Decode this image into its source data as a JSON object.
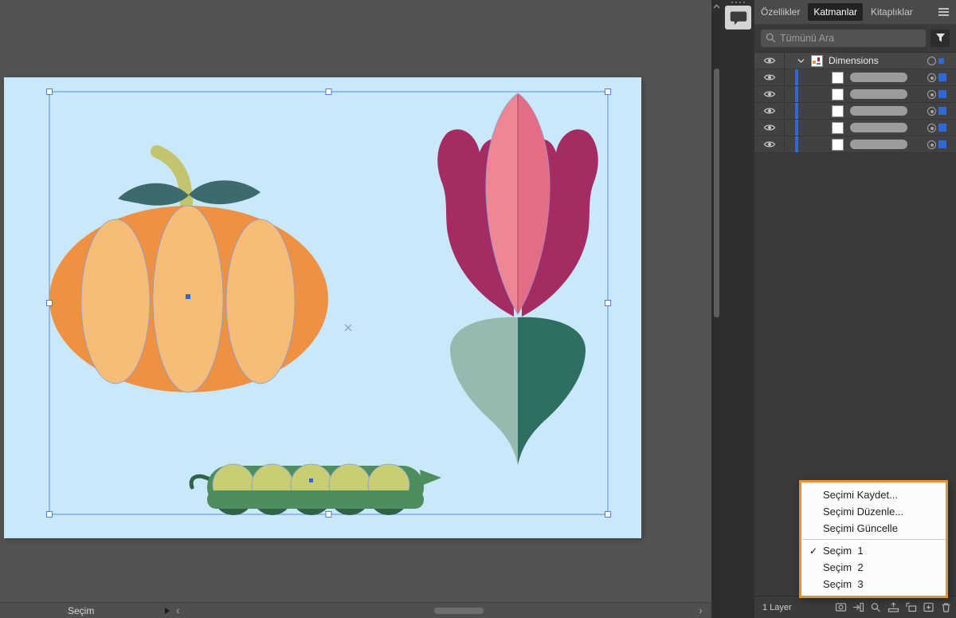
{
  "colors": {
    "accent_blue": "#2e68d9",
    "selection_blue": "#5b8ddb",
    "canvas_bg": "#535353",
    "artboard_bg": "#c9e8fa",
    "panel_bg": "#3a3a3a",
    "menu_highlight_orange": "#e8912f",
    "pumpkin_orange": "#ef9143",
    "pumpkin_light": "#f7bd78",
    "pumpkin_leaf": "#3c6b6d",
    "stem_green": "#c3c46d",
    "beet_leaf_dark": "#a52c63",
    "beet_leaf_pink": "#ee8793",
    "beet_leaf_mid": "#e46d86",
    "beet_root_light": "#95bbb1",
    "beet_root_dark": "#2e6f62",
    "pod_green": "#4e8d5e",
    "pod_dark": "#2f6249",
    "pea_light": "#c9cd73"
  },
  "canvas": {
    "status_label": "Seçim"
  },
  "panel": {
    "tabs": [
      {
        "label": "Özellikler",
        "active": false
      },
      {
        "label": "Katmanlar",
        "active": true
      },
      {
        "label": "Kitaplıklar",
        "active": false
      }
    ],
    "search_placeholder": "Tümünü Ara",
    "layers": {
      "root_name": "Dimensions",
      "sublayer_count": 5
    },
    "status": {
      "layer_count": "1 Layer"
    },
    "bottom_icon_names": [
      "make-clipping-mask-icon",
      "enter-isolation-icon",
      "locate-object-icon",
      "collect-for-export-icon",
      "new-sublayer-icon",
      "new-layer-icon",
      "delete-selection-icon"
    ]
  },
  "icons": {
    "search": "magnifier",
    "filter": "funnel",
    "panel_menu": "hamburger",
    "visibility": "eye",
    "expand": "chevron-down",
    "comments": "speech-bubble",
    "checkmark": "✓"
  },
  "context_menu": {
    "items": [
      {
        "label": "Seçimi Kaydet...",
        "checked": false
      },
      {
        "label": "Seçimi Düzenle...",
        "checked": false
      },
      {
        "label": "Seçimi Güncelle",
        "checked": false
      },
      {
        "type": "separator"
      },
      {
        "label": "Seçim  1",
        "checked": true
      },
      {
        "label": "Seçim  2",
        "checked": false
      },
      {
        "label": "Seçim  3",
        "checked": false
      }
    ]
  }
}
